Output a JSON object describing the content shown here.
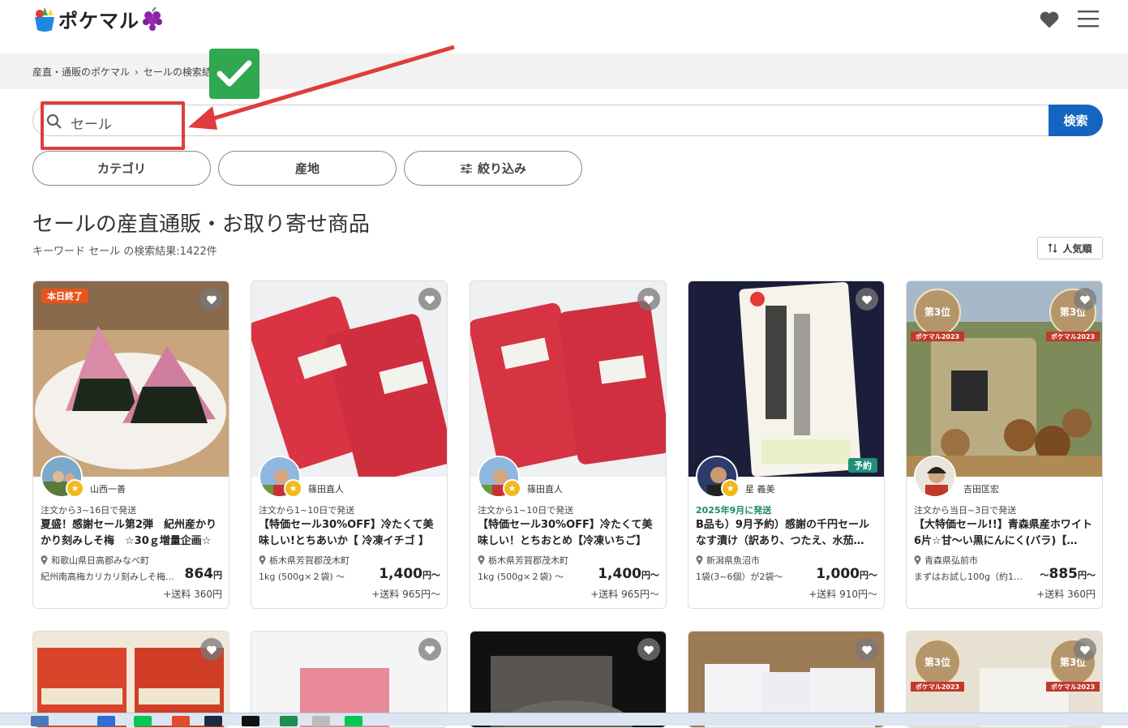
{
  "header": {
    "logo_text": "ポケマル"
  },
  "breadcrumb": {
    "home": "産直・通販のポケマル",
    "separator": "›",
    "current": "セールの検索結果"
  },
  "search": {
    "value": "セール",
    "button_label": "検索"
  },
  "filters": {
    "category": "カテゴリ",
    "origin": "産地",
    "refine": "絞り込み"
  },
  "page_title": "セールの産直通販・お取り寄せ商品",
  "result_count": "キーワード セール の検索結果:1422件",
  "sort": {
    "label": "人気順"
  },
  "products": [
    {
      "badge": "本日終了",
      "seller": "山西一善",
      "shipping": "注文から3~16日で発送",
      "title": "夏盛！感謝セール第2弾　紀州産かりかり刻みしそ梅　☆30ｇ増量企画☆",
      "origin": "和歌山県日高郡みなべ町",
      "spec": "紀州南高梅カリカリ刻みしそ梅…",
      "price": "864",
      "price_unit": "円",
      "shipping_fee": "+送料 360円"
    },
    {
      "badge": "",
      "seller": "篠田直人",
      "shipping": "注文から1~10日で発送",
      "title": "【特価セール30%OFF】冷たくて美味しい!とちあいか【 冷凍イチゴ 】",
      "origin": "栃木県芳賀郡茂木町",
      "spec": "1kg (500g×２袋) ～",
      "price": "1,400",
      "price_unit": "円～",
      "shipping_fee": "+送料 965円～"
    },
    {
      "badge": "",
      "seller": "篠田直人",
      "shipping": "注文から1~10日で発送",
      "title": "【特価セール30%OFF】冷たくて美味しい！とちおとめ【冷凍いちご】",
      "origin": "栃木県芳賀郡茂木町",
      "spec": "1kg (500g×２袋) ～",
      "price": "1,400",
      "price_unit": "円～",
      "shipping_fee": "+送料 965円～"
    },
    {
      "badge": "",
      "seller": "星 義美",
      "shipping": "2025年9月に発送",
      "preorder": "予約",
      "title": "B品も）9月予約）感謝の千円セール なす漬け（訳あり、つたえ、水茄…",
      "origin": "新潟県魚沼市",
      "spec": "1袋(3~6個）が2袋～",
      "price": "1,000",
      "price_unit": "円～",
      "shipping_fee": "+送料 910円～"
    },
    {
      "badge": "",
      "seller": "吉田匡宏",
      "shipping": "注文から当日~3日で発送",
      "title": "【大特価セール!!】青森県産ホワイト6片☆甘～い黒にんにく(バラ)【…",
      "origin": "青森県弘前市",
      "spec": "まずはお試し100g（約10…",
      "price": "885",
      "price_prefix": "～",
      "price_unit": "円～",
      "shipping_fee": "+送料 360円",
      "rank_labels": {
        "rank": "第3位",
        "brand": "ポケマル2023"
      }
    }
  ],
  "colors": {
    "primary_button": "#1565c0",
    "annotation_red": "#e03c3c",
    "check_green": "#2fa84f",
    "badge_orange": "#e8541c"
  }
}
